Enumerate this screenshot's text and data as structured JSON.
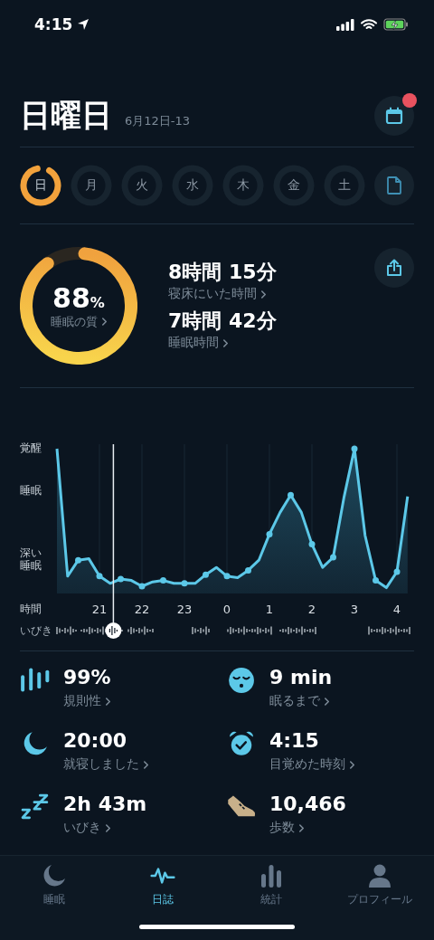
{
  "status_bar": {
    "time": "4:15"
  },
  "header": {
    "title": "日曜日",
    "date_range": "6月12日-13",
    "calendar_has_notification": true
  },
  "days": [
    {
      "label": "日",
      "selected": true
    },
    {
      "label": "月",
      "selected": false
    },
    {
      "label": "火",
      "selected": false
    },
    {
      "label": "水",
      "selected": false
    },
    {
      "label": "木",
      "selected": false
    },
    {
      "label": "金",
      "selected": false
    },
    {
      "label": "土",
      "selected": false
    }
  ],
  "summary": {
    "quality": {
      "value": "88",
      "unit": "%",
      "label": "睡眠の質",
      "level": 0.88
    },
    "metrics": [
      {
        "value": "8時間 15分",
        "label": "寝床にいた時間"
      },
      {
        "value": "7時間 42分",
        "label": "睡眠時間"
      }
    ]
  },
  "chart": {
    "y_labels": [
      "覚醒",
      "睡眠",
      "深い睡眠"
    ],
    "snore_label": "いびき",
    "x_title": "時間",
    "x_labels": [
      "21",
      "22",
      "23",
      "0",
      "1",
      "2",
      "3",
      "4"
    ]
  },
  "stats": [
    {
      "kind": "regularity",
      "value": "99%",
      "label": "規則性"
    },
    {
      "kind": "fall_asleep",
      "value": "9 min",
      "label": "眠るまで"
    },
    {
      "kind": "bedtime",
      "value": "20:00",
      "label": "就寝しました"
    },
    {
      "kind": "wake",
      "value": "4:15",
      "label": "目覚めた時刻"
    },
    {
      "kind": "snore",
      "value": "2h 43m",
      "label": "いびき"
    },
    {
      "kind": "steps",
      "value": "10,466",
      "label": "歩数"
    }
  ],
  "tabs": [
    {
      "kind": "sleep",
      "label": "睡眠",
      "selected": false
    },
    {
      "kind": "journal",
      "label": "日誌",
      "selected": true
    },
    {
      "kind": "stats",
      "label": "統計",
      "selected": false
    },
    {
      "kind": "profile",
      "label": "プロフィール",
      "selected": false
    }
  ]
}
